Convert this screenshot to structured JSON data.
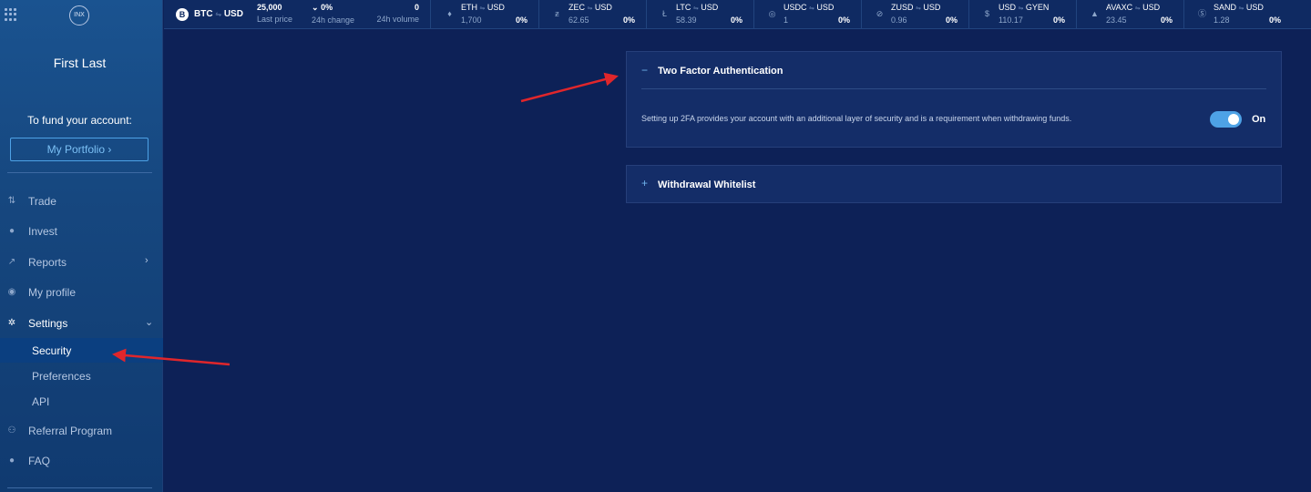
{
  "sidebar": {
    "user_name": "First Last",
    "fund_label": "To fund your account:",
    "portfolio_button": "My Portfolio",
    "logo_text": "INX",
    "items": [
      {
        "label": "Trade",
        "icon": "trade-icon"
      },
      {
        "label": "Invest",
        "icon": "invest-icon"
      },
      {
        "label": "Reports",
        "icon": "reports-icon"
      },
      {
        "label": "My profile",
        "icon": "profile-icon"
      },
      {
        "label": "Settings",
        "icon": "gear-icon"
      },
      {
        "label": "Referral Program",
        "icon": "referral-icon"
      },
      {
        "label": "FAQ",
        "icon": "faq-icon"
      }
    ],
    "settings_sub": [
      {
        "label": "Security"
      },
      {
        "label": "Preferences"
      },
      {
        "label": "API"
      }
    ]
  },
  "ticker": {
    "main": {
      "base": "BTC",
      "quote": "USD",
      "last_price": "25,000",
      "last_price_label": "Last price",
      "change": "0%",
      "change_label": "24h change",
      "volume": "0",
      "volume_label": "24h volume"
    },
    "pairs": [
      {
        "base": "ETH",
        "quote": "USD",
        "price": "1,700",
        "change": "0%"
      },
      {
        "base": "ZEC",
        "quote": "USD",
        "price": "62.65",
        "change": "0%"
      },
      {
        "base": "LTC",
        "quote": "USD",
        "price": "58.39",
        "change": "0%"
      },
      {
        "base": "USDC",
        "quote": "USD",
        "price": "1",
        "change": "0%"
      },
      {
        "base": "ZUSD",
        "quote": "USD",
        "price": "0.96",
        "change": "0%"
      },
      {
        "base": "USD",
        "quote": "GYEN",
        "price": "110.17",
        "change": "0%"
      },
      {
        "base": "AVAXC",
        "quote": "USD",
        "price": "23.45",
        "change": "0%"
      },
      {
        "base": "SAND",
        "quote": "USD",
        "price": "1.28",
        "change": "0%"
      }
    ]
  },
  "security": {
    "two_fa": {
      "title": "Two Factor Authentication",
      "toggle": "−",
      "description": "Setting up 2FA provides your account with an additional layer of security and is a requirement when withdrawing funds.",
      "switch_label": "On",
      "enabled": true
    },
    "whitelist": {
      "title": "Withdrawal Whitelist",
      "toggle": "+"
    }
  },
  "colors": {
    "background": "#0d2157",
    "accent": "#4ea2e6",
    "arrow": "#e0262b"
  }
}
